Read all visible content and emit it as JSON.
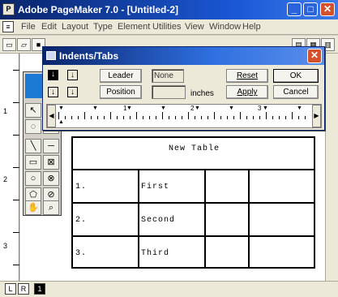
{
  "window": {
    "title": "Adobe PageMaker 7.0 - [Untitled-2]",
    "min_glyph": "_",
    "max_glyph": "□",
    "close_glyph": "✕"
  },
  "menu": [
    "File",
    "Edit",
    "Layout",
    "Type",
    "Element",
    "Utilities",
    "View",
    "Window",
    "Help"
  ],
  "ruler_left": {
    "labels": [
      "1",
      "2",
      "3"
    ]
  },
  "table": {
    "header": "New Table",
    "rows": [
      {
        "num": "1.",
        "text": "First"
      },
      {
        "num": "2.",
        "text": "Second"
      },
      {
        "num": "3.",
        "text": "Third"
      }
    ]
  },
  "bottom": {
    "pages": [
      "L",
      "R",
      "1"
    ]
  },
  "dialog": {
    "title": "Indents/Tabs",
    "close_glyph": "✕",
    "leader_label": "Leader",
    "leader_value": "None",
    "position_label": "Position",
    "position_value": "",
    "units": "inches",
    "reset_label": "Reset",
    "apply_label": "Apply",
    "ok_label": "OK",
    "cancel_label": "Cancel",
    "ruler_labels": [
      "1",
      "2",
      "3"
    ]
  },
  "icons": {
    "align_left": "left-tab-icon",
    "align_right": "right-tab-icon",
    "align_center": "center-tab-icon",
    "align_decimal": "decimal-tab-icon"
  }
}
